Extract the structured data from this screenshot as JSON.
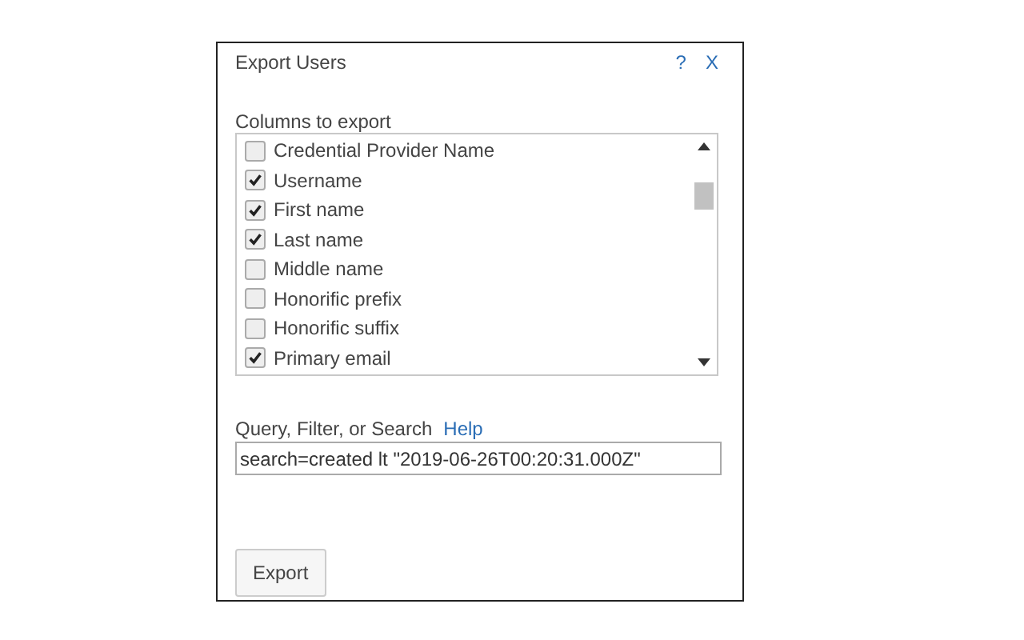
{
  "dialog": {
    "title": "Export Users",
    "help": "?",
    "close": "X"
  },
  "columns": {
    "label": "Columns to export",
    "items": [
      {
        "label": "Credential Provider Name",
        "checked": false
      },
      {
        "label": "Username",
        "checked": true
      },
      {
        "label": "First name",
        "checked": true
      },
      {
        "label": "Last name",
        "checked": true
      },
      {
        "label": "Middle name",
        "checked": false
      },
      {
        "label": "Honorific prefix",
        "checked": false
      },
      {
        "label": "Honorific suffix",
        "checked": false
      },
      {
        "label": "Primary email",
        "checked": true
      }
    ]
  },
  "query": {
    "label": "Query, Filter, or Search",
    "help_link": "Help",
    "value": "search=created lt \"2019-06-26T00:20:31.000Z\""
  },
  "buttons": [
    {
      "label": "Export"
    }
  ]
}
